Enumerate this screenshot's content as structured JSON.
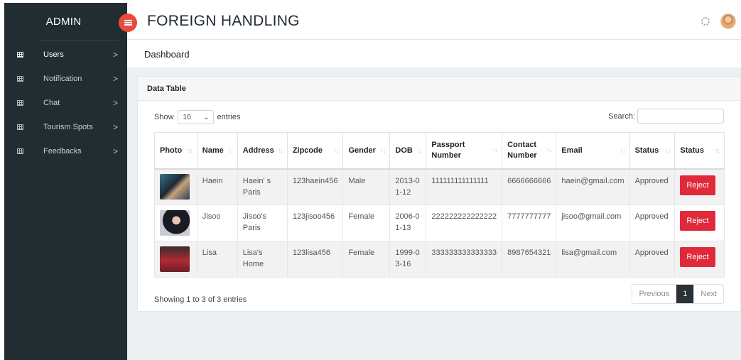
{
  "sidebar": {
    "brand": "ADMIN",
    "items": [
      {
        "label": "Users",
        "chevron": ">"
      },
      {
        "label": "Notification",
        "chevron": ">"
      },
      {
        "label": "Chat",
        "chevron": ">"
      },
      {
        "label": "Tourism Spots",
        "chevron": ">"
      },
      {
        "label": "Feedbacks",
        "chevron": ">"
      }
    ]
  },
  "header": {
    "title": "FOREIGN HANDLING",
    "toggle_icon": "menu-icon",
    "spinner_icon": "loading-icon",
    "avatar_icon": "user-avatar"
  },
  "breadcrumb": "Dashboard",
  "card": {
    "title": "Data Table",
    "show_label": "Show",
    "entries_label": "entries",
    "page_length": "10",
    "search_label": "Search:",
    "search_value": "",
    "columns": [
      "Photo",
      "Name",
      "Address",
      "Zipcode",
      "Gender",
      "DOB",
      "Passport Number",
      "Contact Number",
      "Email",
      "Status",
      "Status"
    ],
    "rows": [
      {
        "name": "Haein",
        "address": "Haein' s Paris",
        "zipcode": "123haein456",
        "gender": "Male",
        "dob": "2013-01-12",
        "passport": "111111111111111",
        "contact": "6666666666",
        "email": "haein@gmail.com",
        "status": "Approved",
        "action": "Reject"
      },
      {
        "name": "Jisoo",
        "address": "Jisoo's Paris",
        "zipcode": "123jisoo456",
        "gender": "Female",
        "dob": "2006-01-13",
        "passport": "222222222222222",
        "contact": "7777777777",
        "email": "jisoo@gmail.com",
        "status": "Approved",
        "action": "Reject"
      },
      {
        "name": "Lisa",
        "address": "Lisa's Home",
        "zipcode": "123lisa456",
        "gender": "Female",
        "dob": "1999-03-16",
        "passport": "333333333333333",
        "contact": "8987654321",
        "email": "lisa@gmail.com",
        "status": "Approved",
        "action": "Reject"
      }
    ],
    "info": "Showing 1 to 3 of 3 entries",
    "pagination": {
      "previous": "Previous",
      "current": "1",
      "next": "Next"
    }
  },
  "colors": {
    "sidebar_bg": "#222d32",
    "accent_red": "#e02a3c",
    "toggle_red": "#e84c3d",
    "page_bg": "#ecf0f3"
  }
}
